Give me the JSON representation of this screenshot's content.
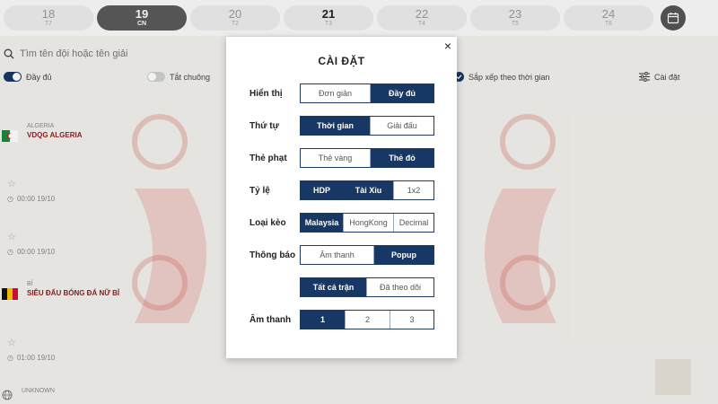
{
  "dates": [
    {
      "num": "18",
      "dow": "T7",
      "state": "normal"
    },
    {
      "num": "19",
      "dow": "CN",
      "state": "active"
    },
    {
      "num": "20",
      "dow": "T2",
      "state": "normal"
    },
    {
      "num": "21",
      "dow": "T3",
      "state": "today"
    },
    {
      "num": "22",
      "dow": "T4",
      "state": "normal"
    },
    {
      "num": "23",
      "dow": "T5",
      "state": "normal"
    },
    {
      "num": "24",
      "dow": "T6",
      "state": "normal"
    }
  ],
  "search": {
    "placeholder": "Tìm tên đội hoặc tên giải"
  },
  "options": {
    "full_label": "Đầy đủ",
    "mute_label": "Tắt chuông",
    "sort_label": "Sắp xếp theo thời gian",
    "settings_label": "Cài đặt"
  },
  "leagues": [
    {
      "country": "ALGERIA",
      "name": "VDQG ALGERIA",
      "flag": "algeria"
    },
    {
      "country": "BỈ",
      "name": "SIÊU ĐẤU BÓNG ĐÁ NỮ BỈ",
      "flag": "belgium"
    },
    {
      "country": "UNKNOWN",
      "name": "",
      "flag": "globe"
    }
  ],
  "matches": [
    {
      "time": "00:00 19/10"
    },
    {
      "time": "00:00 19/10"
    },
    {
      "time": "01:00 19/10"
    }
  ],
  "modal": {
    "title": "CÀI ĐẶT",
    "close": "×",
    "rows": [
      {
        "label": "Hiển thị",
        "buttons": [
          {
            "text": "Đơn giản",
            "sel": false
          },
          {
            "text": "Đầy đủ",
            "sel": true
          }
        ]
      },
      {
        "label": "Thứ tự",
        "buttons": [
          {
            "text": "Thời gian",
            "sel": true
          },
          {
            "text": "Giải đấu",
            "sel": false
          }
        ]
      },
      {
        "label": "Thẻ phạt",
        "buttons": [
          {
            "text": "Thẻ vàng",
            "sel": false
          },
          {
            "text": "Thẻ đỏ",
            "sel": true
          }
        ]
      },
      {
        "label": "Tỷ lệ",
        "buttons": [
          {
            "text": "HDP",
            "sel": true
          },
          {
            "text": "Tài Xỉu",
            "sel": true
          },
          {
            "text": "1x2",
            "sel": false
          }
        ]
      },
      {
        "label": "Loại kèo",
        "buttons": [
          {
            "text": "Malaysia",
            "sel": true
          },
          {
            "text": "HongKong",
            "sel": false
          },
          {
            "text": "Decimal",
            "sel": false
          }
        ]
      },
      {
        "label": "Thông báo",
        "buttons": [
          {
            "text": "Âm thanh",
            "sel": false
          },
          {
            "text": "Popup",
            "sel": true
          }
        ]
      },
      {
        "label": "",
        "buttons": [
          {
            "text": "Tất cả trận",
            "sel": true
          },
          {
            "text": "Đã theo dõi",
            "sel": false
          }
        ]
      },
      {
        "label": "Âm thanh",
        "buttons": [
          {
            "text": "1",
            "sel": true
          },
          {
            "text": "2",
            "sel": false
          },
          {
            "text": "3",
            "sel": false
          }
        ]
      }
    ]
  }
}
